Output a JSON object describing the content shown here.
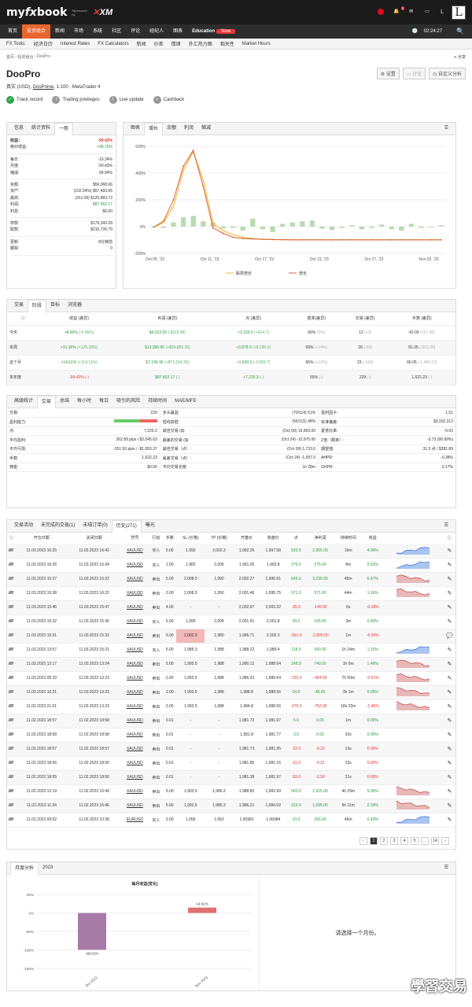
{
  "header": {
    "logo_my": "my",
    "logo_fx": "fx",
    "logo_book": "book",
    "sponsor": "Sponsored by",
    "xm": "XM",
    "notif_count": "2",
    "user_initial": "L"
  },
  "nav": {
    "items": [
      "首页",
      "投资组合",
      "新闻",
      "市场",
      "系统",
      "社区",
      "评论",
      "经纪人",
      "图表"
    ],
    "education": "Education",
    "new_badge": "New",
    "clock": "02:24:27"
  },
  "subnav": [
    "FX Tools:",
    "经济日历",
    "Interest Rates",
    "FX Calculators",
    "新闻",
    "价差",
    "情绪",
    "外汇热力图",
    "相关性",
    "Market Hours"
  ],
  "breadcrumb": {
    "home": "首页",
    "portfolio": "投资组合",
    "current": "DooPro",
    "share": "分享"
  },
  "title": "DooPro",
  "buttons": {
    "settings": "设置",
    "discuss": "讨论",
    "custom": "自定义分析"
  },
  "account": {
    "pre": "真实 (USD),",
    "broker": "DooPrime",
    "post": ", 1:100 , MetaTrader 4"
  },
  "checks": [
    {
      "label": "Track record",
      "ok": true
    },
    {
      "label": "Trading privileges",
      "ok": false
    },
    {
      "label": "Live update",
      "ok": false
    },
    {
      "label": "Cashback",
      "ok": false
    }
  ],
  "info": {
    "tabs": [
      "信息",
      "统计资料",
      "一般"
    ],
    "rows1": [
      {
        "k": "收益：",
        "v": "-99.43%",
        "c": "red"
      },
      {
        "k": "绝对增益：",
        "v": "+48.76%",
        "c": "grn"
      }
    ],
    "rows2": [
      {
        "k": "每日",
        "v": "-16.34%"
      },
      {
        "k": "月度:",
        "v": "-99.43%"
      },
      {
        "k": "缩减:",
        "v": "99.94%"
      }
    ],
    "rows3": [
      {
        "k": "余额:",
        "v": "$56,068.66"
      },
      {
        "k": "资产:",
        "v": "(102.54%) $57,493.66"
      },
      {
        "k": "最高:",
        "v": "(Oct 09) $120,883.72"
      },
      {
        "k": "利润:",
        "v": "$87,452.17",
        "c": "grn"
      },
      {
        "k": "利息:",
        "v": "$0.00"
      }
    ],
    "rows4": [
      {
        "k": "存款:",
        "v": "$179,343.28"
      },
      {
        "k": "取款:",
        "v": "$210,726.79"
      }
    ],
    "rows5": [
      {
        "k": "更新:",
        "v": "8分钟前"
      },
      {
        "k": "跟踪:",
        "v": "0"
      }
    ]
  },
  "chart_panel": {
    "tabs": [
      "图表",
      "增长",
      "余额",
      "利润",
      "缩减"
    ],
    "chart_data": {
      "type": "line",
      "yticks": [
        "600%",
        "400%",
        "200%",
        "0%",
        "-200%"
      ],
      "ylim": [
        -200,
        600
      ],
      "x": [
        "Oct 05, '23",
        "Oct 11, '23",
        "Oct 17, '23",
        "Oct 23, '23",
        "Oct 27, '23",
        "Nov 02, '23"
      ],
      "series": [
        {
          "name": "股票增长",
          "values": [
            -5,
            30,
            150,
            420,
            560,
            350,
            20,
            -30,
            -60,
            -80,
            -90,
            -95,
            -97,
            -98,
            -99,
            -99,
            -99,
            -99,
            -99,
            -99,
            -99,
            -99,
            -99,
            -99,
            -99,
            -99,
            -99,
            -99,
            -99,
            -99
          ]
        },
        {
          "name": "增长",
          "values": [
            -5,
            40,
            200,
            450,
            570,
            300,
            -10,
            -50,
            -80,
            -90,
            -93,
            -95,
            -97,
            -98,
            -99,
            -99,
            -99,
            -99,
            -99,
            -99,
            -99,
            -99,
            -99,
            -99,
            -99,
            -99,
            -99,
            -99,
            -99,
            -99
          ]
        }
      ],
      "bars": [
        5,
        -10,
        30,
        70,
        80,
        40,
        30,
        -15,
        -10,
        -30,
        60,
        -20,
        -40,
        20,
        30,
        40,
        45,
        -15,
        -25,
        -10,
        10,
        -20,
        -10,
        15,
        -20,
        -30,
        20,
        -10,
        -5,
        10
      ]
    }
  },
  "period": {
    "tabs": [
      "交易",
      "阶段",
      "目标",
      "浏览器"
    ],
    "headers": [
      "收益 (差异)",
      "利润 (差异)",
      "点 (差异)",
      "胜率(差异)",
      "交易 (差异)",
      "手数 (差异)"
    ],
    "rows": [
      {
        "label": "今天",
        "c": [
          "+8.00%",
          "(-0.96%)",
          "$4,153.00",
          "(-$115.96)",
          "+1,150.0",
          "(+414.7)",
          "66%",
          "(0%)",
          "12",
          "(+3)",
          "42.00",
          "(+27.95)"
        ],
        "col": [
          "grn",
          "grn",
          "grn",
          "",
          ""
        ]
      },
      {
        "label": "本周",
        "c": [
          "+31.36%",
          "(+125.18%)",
          "$13,386.96",
          "(+$59,855.26)",
          "+2,878.3",
          "(+8,286.3)",
          "69%",
          "(+24%)",
          "26",
          "(-59)",
          "81.05",
          "(-503.05)"
        ],
        "col": [
          "grn",
          "grn",
          "grn",
          "",
          ""
        ]
      },
      {
        "label": "这个月",
        "c": [
          "+14.61%",
          "(+114.11%)",
          "$7,146.96",
          "(+$73,158.25)",
          "+1,630.3",
          "(-3,959.7)",
          "65%",
          "(+12%)",
          "23",
          "(-183)",
          "66.05",
          "(-1,490.13)"
        ],
        "col": [
          "grn",
          "grn",
          "grn",
          "",
          ""
        ]
      },
      {
        "label": "本年度",
        "c": [
          "-99.43%",
          "(-)",
          "$87,452.17",
          "(-)",
          "+7,220.3",
          "(-)",
          "55%",
          "(-)",
          "229",
          "(-)",
          "1,622.23",
          "(-)"
        ],
        "col": [
          "red",
          "grn",
          "grn",
          "",
          ""
        ]
      }
    ]
  },
  "stats": {
    "tabs": [
      "高级统计",
      "交易",
      "总结",
      "每小时",
      "每日",
      "吸引的风险",
      "持续时间",
      "MAE/MFE"
    ],
    "rows": [
      [
        "交易:",
        "229",
        "多头赢益:",
        "(70/114) 61%",
        "盈利因子:",
        "1.51"
      ],
      [
        "盈利能力:",
        "",
        "短线获胜:",
        "(56/115) 48%",
        "标准偏差:",
        "$3,332.313"
      ],
      [
        "点:",
        "7,220.3",
        "最佳交易 ($):",
        "(Oct 09) 19,950.00",
        "夏普比率:",
        "-0.02"
      ],
      [
        "平均盈利:",
        "262.89 pips / $2,045.63",
        "最差的交易 ($):",
        "(Oct 24) -10,970.00",
        "Z值（概率）:",
        "-3.73 (99.99%)"
      ],
      [
        "平均亏损:",
        "-251.50 pips / -$1,653.37",
        "最佳交易（点）:",
        "(Oct 09) 1,733.0",
        "期望值:",
        "31.5 点 / $381.89"
      ],
      [
        "手数:",
        "1,622.23",
        "最差交易（点）:",
        "(Oct 24) -1,097.0",
        "AHPR:",
        "-0.38%"
      ],
      [
        "佣金:",
        "$0.00",
        "平均交易长度:",
        "1h 28m",
        "GHPR:",
        "0.17%"
      ]
    ],
    "bar_win_pct": 61
  },
  "history": {
    "tabs": [
      "交易活动",
      "未完成的交易(1)",
      "未结订单(0)",
      "历史(271)",
      "曝光"
    ],
    "headers": [
      "开仓日期",
      "关闭日期",
      "符号",
      "行动",
      "手数",
      "SL (价格)",
      "TP (价格)",
      "开盘价",
      "收盘价",
      "点",
      "净利润",
      "持续时间",
      "收益"
    ],
    "rows": [
      [
        "11.03.2023 16:25",
        "11.03.2023 16:42",
        "XAUUSD",
        "买入",
        "5.00",
        "1,992",
        "2,002.3",
        "1,992.25",
        "1,997.58",
        "533.0",
        "2,665.00",
        "16m",
        "4.99%",
        "g",
        "u"
      ],
      [
        "11.03.2023 16:26",
        "11.03.2023 16:34",
        "XAUUSD",
        "买入",
        "1.00",
        "1,982",
        "2,006",
        "1,991.05",
        "1,993.8",
        "275.0",
        "275.00",
        "8m",
        "0.52%",
        "g",
        "u"
      ],
      [
        "11.03.2023 15:37",
        "11.03.2023 16:22",
        "XAUUSD",
        "卖出",
        "5.00",
        "2,008.5",
        "1,990",
        "2,002.27",
        "1,995.81",
        "646.0",
        "3,230.00",
        "45m",
        "6.47%",
        "g",
        "d"
      ],
      [
        "11.03.2023 15:38",
        "11.03.2023 16:22",
        "XAUUSD",
        "卖出",
        "2.00",
        "2,008.5",
        "1,990",
        "2,001.46",
        "1,995.75",
        "571.0",
        "571.00",
        "44m",
        "1.16%",
        "g",
        "d"
      ],
      [
        "11.03.2023 15:46",
        "11.03.2023 15:47",
        "XAUUSD",
        "卖出",
        "4.00",
        "-",
        "-",
        "2,002.97",
        "2,003.32",
        "-35.0",
        "-140.00",
        "6s",
        "-0.28%",
        "r",
        ""
      ],
      [
        "11.03.2023 15:32",
        "11.03.2023 15:36",
        "XAUUSD",
        "买入",
        "5.00",
        "1,995",
        "2,008",
        "2,001.41",
        "2,001.8",
        "39.0",
        "195.00",
        "3m",
        "0.40%",
        "g",
        ""
      ],
      [
        "11.03.2023 15:31",
        "11.03.2023 15:32",
        "XAUUSD",
        "卖出",
        "5.00",
        "2,002.3",
        "1,980",
        "1,996.71",
        "2,002.3",
        "-561.0",
        "-2,805.00",
        "1m",
        "-5.39%",
        "r",
        ""
      ],
      [
        "11.03.2023 13:57",
        "11.03.2023 15:21",
        "XAUUSD",
        "买入",
        "5.00",
        "1,985.3",
        "1,988",
        "1,988.22",
        "1,989.4",
        "118.0",
        "590.00",
        "1h 24m",
        "1.15%",
        "g",
        "u"
      ],
      [
        "11.03.2023 12:17",
        "11.03.2023 13:24",
        "XAUUSD",
        "卖出",
        "5.00",
        "1,993.5",
        "1,988",
        "1,990.12",
        "1,988.64",
        "148.0",
        "740.00",
        "1h 6m",
        "1.46%",
        "g",
        "d"
      ],
      [
        "11.03.2023 05:33",
        "11.03.2023 13:23",
        "XAUUSD",
        "卖出",
        "2.00",
        "1,993.5",
        "1,988",
        "1,986.32",
        "1,988.64",
        "-232.0",
        "-464.00",
        "7h 50m",
        "-0.91%",
        "r",
        "d"
      ],
      [
        "11.03.2023 10:21",
        "11.03.2023 13:23",
        "XAUUSD",
        "卖出",
        "2.00",
        "1,993.5",
        "1,988",
        "1,988.8",
        "1,988.56",
        "24.0",
        "48.00",
        "3h 1m",
        "0.09%",
        "g",
        "d"
      ],
      [
        "11.02.2023 21:01",
        "11.03.2023 13:23",
        "XAUUSD",
        "卖出",
        "2.00",
        "1,993.5",
        "1,988",
        "1,984.8",
        "1,988.56",
        "-376.0",
        "-752.00",
        "16h 22m",
        "-1.45%",
        "r",
        "d"
      ],
      [
        "11.02.2023 18:57",
        "11.02.2023 18:58",
        "XAUUSD",
        "卖出",
        "0.01",
        "-",
        "-",
        "1,981.72",
        "1,981.67",
        "5.0",
        "0.05",
        "1m",
        "0.00%",
        "g",
        ""
      ],
      [
        "11.02.2023 18:58",
        "11.02.2023 18:58",
        "XAUUSD",
        "卖出",
        "0.01",
        "-",
        "-",
        "1,981.8",
        "1,981.77",
        "3.0",
        "0.03",
        "33s",
        "0.00%",
        "g",
        ""
      ],
      [
        "11.02.2023 18:57",
        "11.02.2023 18:57",
        "XAUUSD",
        "卖出",
        "0.01",
        "-",
        "-",
        "1,981.73",
        "1,981.95",
        "-22.0",
        "-0.22",
        "13s",
        "0.00%",
        "r",
        ""
      ],
      [
        "11.02.2023 18:56",
        "11.02.2023 18:56",
        "XAUUSD",
        "卖出",
        "0.01",
        "-",
        "-",
        "1,981.85",
        "1,982.16",
        "-31.0",
        "-0.31",
        "23s",
        "0.00%",
        "r",
        ""
      ],
      [
        "11.02.2023 18:55",
        "11.02.2023 18:56",
        "XAUUSD",
        "卖出",
        "0.01",
        "-",
        "-",
        "1,981.38",
        "1,981.97",
        "-59.0",
        "-0.59",
        "21s",
        "0.00%",
        "r",
        ""
      ],
      [
        "11.02.2023 12:19",
        "11.02.2023 16:49",
        "XAUUSD",
        "卖出",
        "5.00",
        "1,993.5",
        "1,980.2",
        "1,988.82",
        "1,982.99",
        "583.0",
        "2,915.00",
        "4h 29m",
        "5.95%",
        "g",
        "d"
      ],
      [
        "11.02.2023 11:34",
        "11.02.2023 16:46",
        "XAUUSD",
        "卖出",
        "5.00",
        "1,993.5",
        "1,980.2",
        "1,986.21",
        "1,984.02",
        "219.0",
        "1,095.00",
        "5h 11m",
        "2.29%",
        "g",
        "d"
      ],
      [
        "11.02.2023 09:52",
        "11.02.2023 10:38",
        "EURUSD",
        "买入",
        "2.00",
        "1.056",
        "1.063",
        "1.05981",
        "1.06084",
        "10.3",
        "206.00",
        "46m",
        "0.43%",
        "g",
        "u"
      ]
    ],
    "pages": [
      "1",
      "2",
      "3",
      "4",
      "5",
      "...",
      "14"
    ]
  },
  "monthly": {
    "tabs": [
      "月度分析",
      "2023"
    ],
    "placeholder": "请选择一个月份。",
    "chart_data": {
      "type": "bar",
      "title": "每月收益(变化)",
      "categories": [
        "Oct 2023",
        "Nov 2023"
      ],
      "values": [
        -99.51,
        14.61
      ],
      "labels": [
        "-99.51%",
        "14.61%"
      ],
      "yticks": [
        "50%",
        "0%",
        "-50%",
        "-100%",
        "-150%"
      ],
      "ylim": [
        -150,
        50
      ],
      "colors": [
        "#a87aa8",
        "#e07070"
      ]
    }
  },
  "watermark": "學習交易",
  "colors": {
    "accent": "#e8662e",
    "green": "#2a9a3a",
    "red": "#d33"
  }
}
